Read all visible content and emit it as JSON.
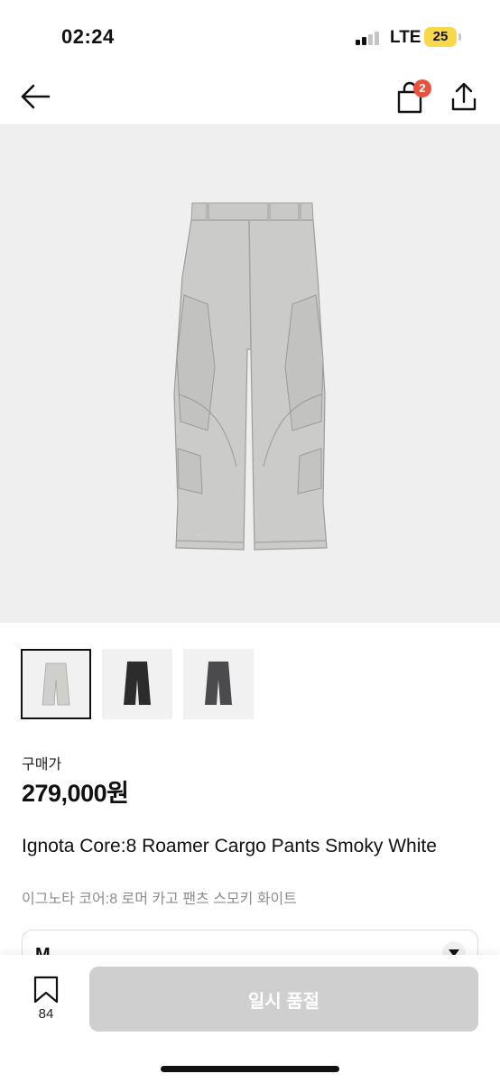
{
  "status_bar": {
    "time": "02:24",
    "network": "LTE",
    "battery": "25"
  },
  "nav": {
    "back_icon": "arrow-left-icon",
    "cart_icon": "shopping-bag-icon",
    "cart_badge": "2",
    "share_icon": "share-icon"
  },
  "gallery": {
    "hero_alt": "Ignota Core:8 Roamer Cargo Pants Smoky White",
    "thumbnails": [
      {
        "color": "#cfcfcc",
        "selected": true
      },
      {
        "color": "#2c2c2c",
        "selected": false
      },
      {
        "color": "#4b4b4d",
        "selected": false
      }
    ]
  },
  "product": {
    "price_label": "구매가",
    "price": "279,000원",
    "name_en": "Ignota Core:8 Roamer Cargo Pants Smoky White",
    "name_ko": "이그노타 코어:8 로머 카고 팬츠 스모키 화이트"
  },
  "size_select": {
    "value": "M"
  },
  "bottom_bar": {
    "bookmark_icon": "bookmark-icon",
    "bookmark_count": "84",
    "cta_label": "일시 품절"
  },
  "colors": {
    "badge": "#e8533f",
    "cta_disabled": "#cfcfcf",
    "battery": "#f7d84a"
  }
}
